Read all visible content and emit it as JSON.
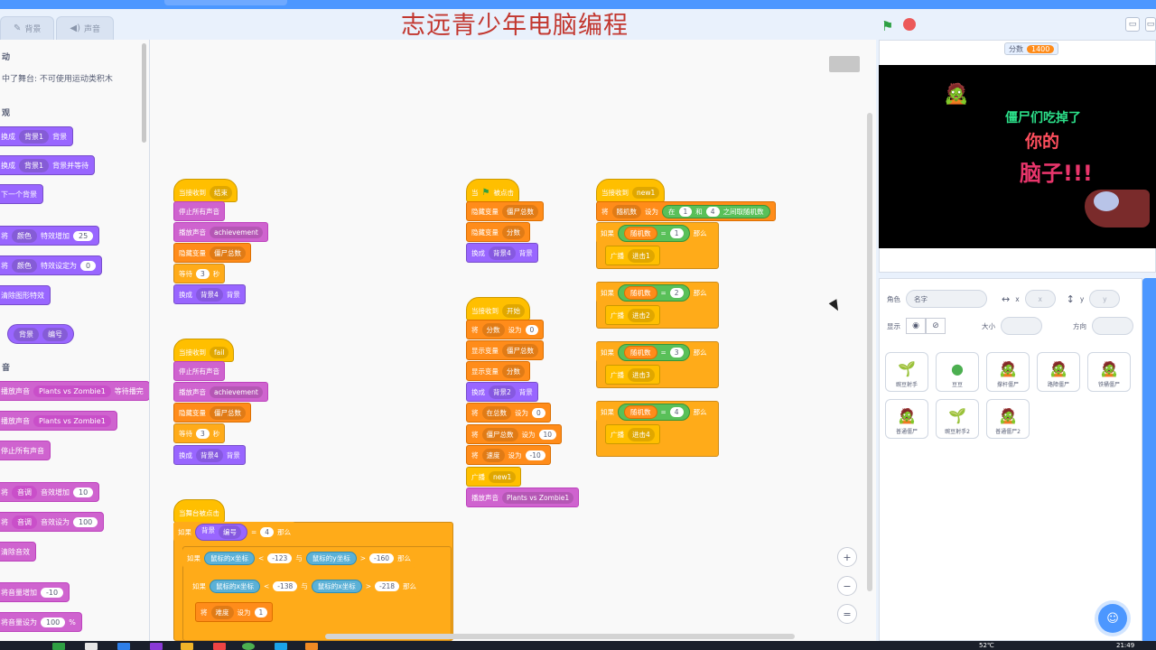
{
  "watermark": "志远青少年电脑编程",
  "tabs": [
    {
      "label": "背景",
      "icon": "brush-icon"
    },
    {
      "label": "声音",
      "icon": "speaker-icon"
    }
  ],
  "palette": {
    "motion_title": "动",
    "motion_note": "中了舞台: 不可使用运动类积木",
    "looks_title": "观",
    "looks": [
      {
        "pre": "换成",
        "dd": "背景1",
        "post": "背景"
      },
      {
        "pre": "换成",
        "dd": "背景1",
        "post": "背景并等待"
      },
      {
        "pre": "下一个背景",
        "dd": "",
        "post": ""
      },
      {
        "pre": "将",
        "dd": "颜色",
        "post": "特效增加",
        "num": "25"
      },
      {
        "pre": "将",
        "dd": "颜色",
        "post": "特效设定为",
        "num": "0"
      },
      {
        "pre": "清除图形特效",
        "dd": "",
        "post": ""
      },
      {
        "pre": "",
        "dd": "背景",
        "post": "",
        "dd2": "编号"
      }
    ],
    "sound_title": "音",
    "sound": [
      {
        "pre": "播放声音",
        "dd": "Plants vs Zombie1",
        "post": "等待播完"
      },
      {
        "pre": "播放声音",
        "dd": "Plants vs Zombie1",
        "post": ""
      },
      {
        "pre": "停止所有声音",
        "dd": "",
        "post": ""
      },
      {
        "pre": "将",
        "dd": "音调",
        "post": "音效增加",
        "num": "10"
      },
      {
        "pre": "将",
        "dd": "音调",
        "post": "音效设为",
        "num": "100"
      },
      {
        "pre": "清除音效",
        "dd": "",
        "post": ""
      },
      {
        "pre": "将音量增加",
        "dd": "",
        "post": "",
        "num": "-10"
      },
      {
        "pre": "将音量设为",
        "dd": "",
        "post": "%",
        "num": "100"
      }
    ]
  },
  "scripts": {
    "s1": {
      "hat": "当接收到",
      "hat_dd": "结束",
      "b1": "停止所有声音",
      "b2": "播放声音",
      "b2_dd": "achievement",
      "b3": "隐藏变量",
      "b3_dd": "僵尸总数",
      "b4": "等待",
      "b4_num": "3",
      "b4_post": "秒",
      "b5": "换成",
      "b5_dd": "背景4",
      "b5_post": "背景"
    },
    "s2": {
      "hat": "当接收到",
      "hat_dd": "fail",
      "b1": "停止所有声音",
      "b2": "播放声音",
      "b2_dd": "achievement",
      "b3": "隐藏变量",
      "b3_dd": "僵尸总数",
      "b4": "等待",
      "b4_num": "3",
      "b4_post": "秒",
      "b5": "换成",
      "b5_dd": "背景4",
      "b5_post": "背景"
    },
    "s3": {
      "hat": "当",
      "hat_post": "被点击",
      "b1": "隐藏变量",
      "b1_dd": "僵尸总数",
      "b2": "隐藏变量",
      "b2_dd": "分数",
      "b3": "换成",
      "b3_dd": "背景4",
      "b3_post": "背景"
    },
    "s4": {
      "hat": "当接收到",
      "hat_dd": "开始",
      "b1": "将",
      "b1_dd": "分数",
      "b1_mid": "设为",
      "b1_num": "0",
      "b2": "显示变量",
      "b2_dd": "僵尸总数",
      "b3": "显示变量",
      "b3_dd": "分数",
      "b4": "换成",
      "b4_dd": "背景2",
      "b4_post": "背景",
      "b5": "将",
      "b5_dd": "在总数",
      "b5_mid": "设为",
      "b5_num": "0",
      "b6": "将",
      "b6_dd": "僵尸总数",
      "b6_mid": "设为",
      "b6_num": "10",
      "b7": "将",
      "b7_dd": "速度",
      "b7_mid": "设为",
      "b7_num": "-10",
      "b8": "广播",
      "b8_dd": "new1",
      "b9": "播放声音",
      "b9_dd": "Plants vs Zombie1"
    },
    "s5": {
      "hat": "当接收到",
      "hat_dd": "new1",
      "b1": "将",
      "b1_dd": "随机数",
      "b1_mid": "设为",
      "b1_op_pre": "在",
      "b1_n1": "1",
      "b1_op_mid": "和",
      "b1_n2": "4",
      "b1_op_post": "之间取随机数",
      "ifs": [
        {
          "if": "如果",
          "var": "随机数",
          "eq": "=",
          "n": "1",
          "then": "那么",
          "bc": "广播",
          "bc_dd": "进击1"
        },
        {
          "if": "如果",
          "var": "随机数",
          "eq": "=",
          "n": "2",
          "then": "那么",
          "bc": "广播",
          "bc_dd": "进击2"
        },
        {
          "if": "如果",
          "var": "随机数",
          "eq": "=",
          "n": "3",
          "then": "那么",
          "bc": "广播",
          "bc_dd": "进击3"
        },
        {
          "if": "如果",
          "var": "随机数",
          "eq": "=",
          "n": "4",
          "then": "那么",
          "bc": "广播",
          "bc_dd": "进击4"
        }
      ]
    },
    "s6": {
      "hat": "当舞台被点击",
      "if1": "如果",
      "if1_dd": "背景",
      "if1_dd2": "编号",
      "if1_eq": "=",
      "if1_n": "4",
      "if1_then": "那么",
      "if2": "如果",
      "if2_a": "鼠标的x坐标",
      "if2_lt": "<",
      "if2_n1": "-123",
      "if2_and": "与",
      "if2_b": "鼠标的y坐标",
      "if2_gt": ">",
      "if2_n2": "-160",
      "if2_then": "那么",
      "if3": "如果",
      "if3_a": "鼠标的x坐标",
      "if3_lt": "<",
      "if3_n1": "-138",
      "if3_and": "与",
      "if3_b": "鼠标的x坐标",
      "if3_gt": ">",
      "if3_n2": "-218",
      "if3_then": "那么",
      "b1": "将",
      "b1_dd": "难度",
      "b1_mid": "设为",
      "b1_num": "1"
    }
  },
  "stage": {
    "score_label": "分数",
    "score_value": "1400",
    "msg_line1": "僵尸们吃掉了",
    "msg_line2": "你的",
    "msg_line3": "脑子!!!"
  },
  "sprite_info": {
    "sprite_label": "角色",
    "sprite_name_placeholder": "名字",
    "x_label": "x",
    "x_value": "x",
    "y_label": "y",
    "y_value": "y",
    "show_label": "显示",
    "size_label": "大小",
    "direction_label": "方向"
  },
  "sprites": [
    {
      "name": "豌豆射手",
      "thumb": "🌱"
    },
    {
      "name": "豆豆",
      "thumb": "●"
    },
    {
      "name": "撑杆僵尸",
      "thumb": "🧟"
    },
    {
      "name": "路障僵尸",
      "thumb": "🧟"
    },
    {
      "name": "铁桶僵尸",
      "thumb": "🧟"
    },
    {
      "name": "普通僵尸",
      "thumb": "🧟"
    },
    {
      "name": "豌豆射手2",
      "thumb": "🌱"
    },
    {
      "name": "普通僵尸2",
      "thumb": "🧟"
    }
  ],
  "taskbar": {
    "temp": "52℃",
    "time": "21:49"
  },
  "colors": {
    "accent": "#4c97ff",
    "events": "#ffbf00",
    "control": "#ffab19",
    "variables": "#ff8c1a",
    "looks": "#9966ff",
    "sound": "#cf63cf",
    "operators": "#59c059",
    "sensing": "#5cb1d6"
  }
}
